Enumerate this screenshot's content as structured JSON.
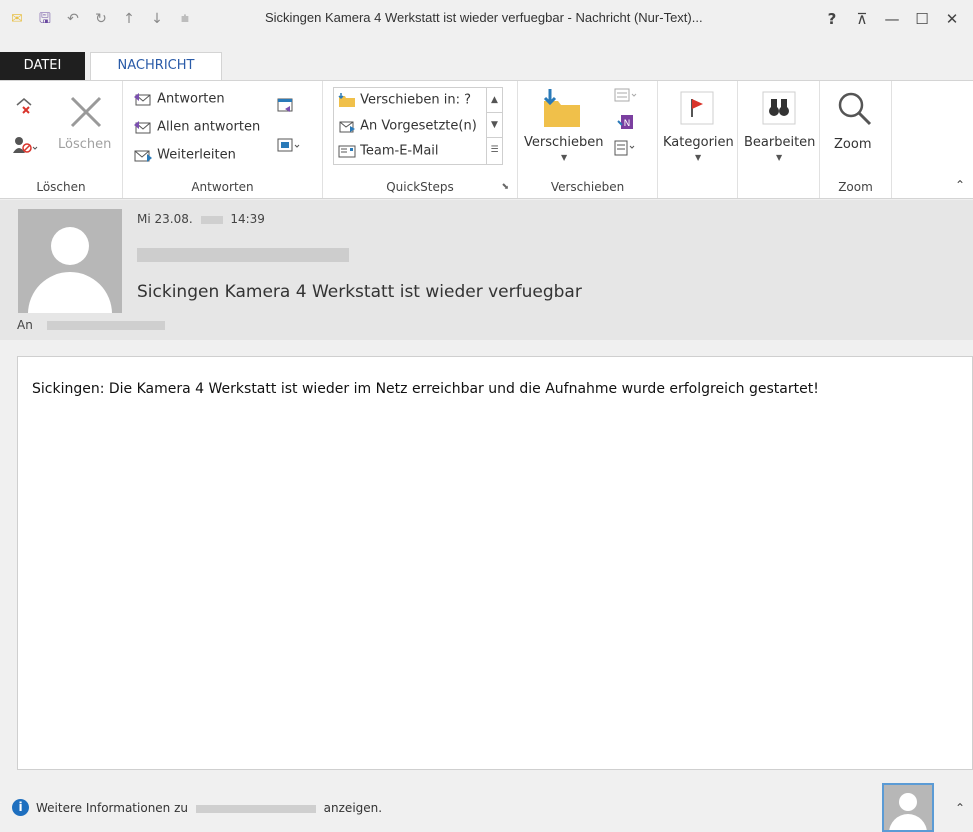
{
  "window": {
    "title": "Sickingen Kamera 4 Werkstatt ist wieder verfuegbar - Nachricht (Nur-Text)...",
    "help": "?",
    "restore_ribbon": "⊼",
    "minimize": "—",
    "maximize": "☐",
    "close": "✕"
  },
  "qat": {
    "mail_icon": "✉",
    "save_icon": "🖫",
    "undo_icon": "↶",
    "redo_icon": "↻",
    "up_icon": "↑",
    "down_icon": "↓",
    "customize_icon": "⩧"
  },
  "tabs": {
    "file": "DATEI",
    "message": "NACHRICHT"
  },
  "ribbon": {
    "delete_group": {
      "label": "Löschen",
      "delete_button": "Löschen"
    },
    "respond_group": {
      "label": "Antworten",
      "reply": "Antworten",
      "reply_all": "Allen antworten",
      "forward": "Weiterleiten"
    },
    "quicksteps_group": {
      "label": "QuickSteps",
      "items": [
        "Verschieben in: ?",
        "An Vorgesetzte(n)",
        "Team-E-Mail"
      ]
    },
    "move_group": {
      "label": "Verschieben",
      "move_button": "Verschieben"
    },
    "tags": {
      "categories": "Kategorien"
    },
    "editing": {
      "edit": "Bearbeiten"
    },
    "zoom_group": {
      "label": "Zoom",
      "zoom_button": "Zoom"
    }
  },
  "header": {
    "date_prefix": "Mi 23.08.",
    "time": "14:39",
    "subject": "Sickingen Kamera 4 Werkstatt ist wieder verfuegbar",
    "to_label": "An"
  },
  "message": {
    "body": "Sickingen: Die Kamera 4 Werkstatt ist wieder im Netz erreichbar und die Aufnahme wurde erfolgreich gestartet!"
  },
  "footer": {
    "info_prefix": "Weitere Informationen zu",
    "info_suffix": "anzeigen."
  },
  "colors": {
    "accent": "#2a5ba8",
    "file_tab_bg": "#1f1f1f",
    "info_blue": "#1e6fbf",
    "flag_red": "#d9342b"
  }
}
